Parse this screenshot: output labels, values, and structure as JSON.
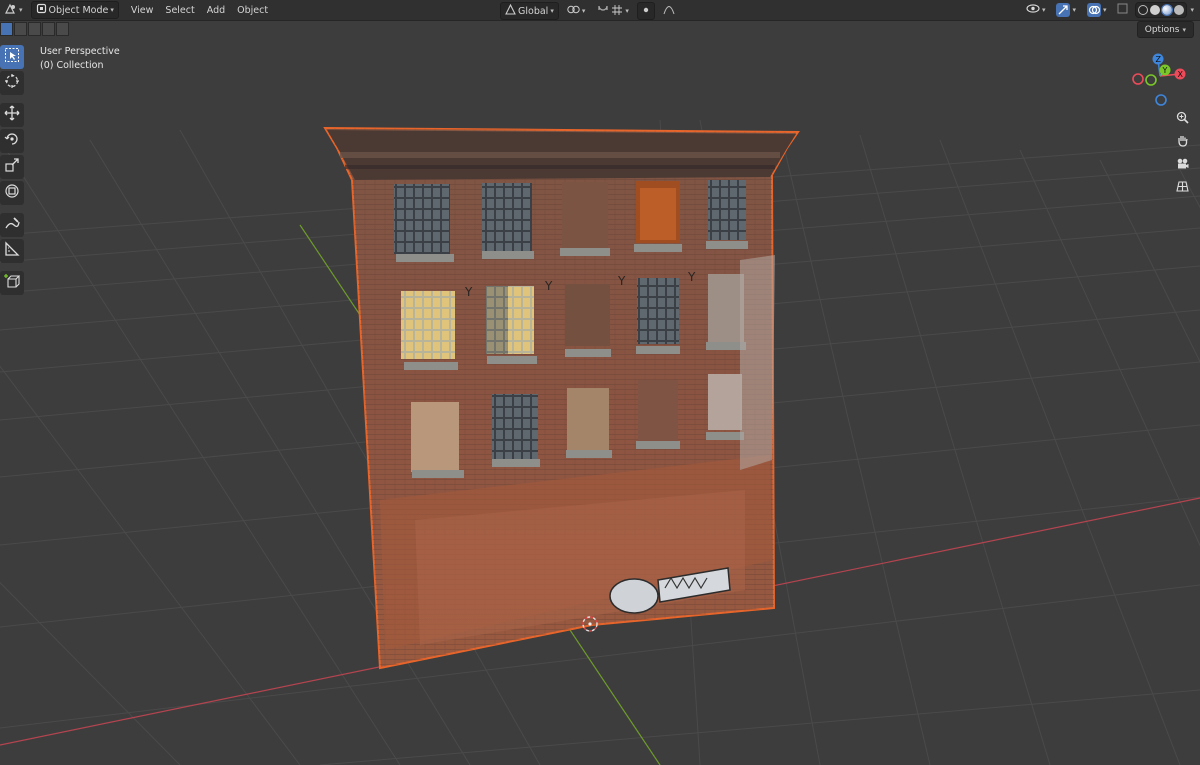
{
  "header": {
    "mode_label": "Object Mode",
    "menus": [
      "View",
      "Select",
      "Add",
      "Object"
    ],
    "transform_orientation": "Global"
  },
  "toolbar_row2": {
    "options_label": "Options"
  },
  "viewport": {
    "view_name": "User Perspective",
    "collection_label": "(0) Collection"
  },
  "gizmo": {
    "x_label": "X",
    "y_label": "Y",
    "z_label": "Z"
  },
  "icons": {
    "editor_type": "editor-type-icon",
    "select_box": "select-box-icon",
    "cursor": "cursor-icon",
    "move": "move-icon",
    "rotate": "rotate-icon",
    "scale": "scale-icon",
    "transform": "transform-icon",
    "annotate": "annotate-icon",
    "measure": "measure-icon",
    "add_cube": "add-cube-icon",
    "zoom": "zoom-icon",
    "pan": "pan-hand-icon",
    "camera": "camera-icon",
    "grid": "grid-icon"
  },
  "colors": {
    "selection_outline": "#e8652b",
    "active_tool": "#4772b3",
    "x_axis": "#ed4b5a",
    "y_axis": "#7ac72a",
    "z_axis": "#3e86db"
  }
}
